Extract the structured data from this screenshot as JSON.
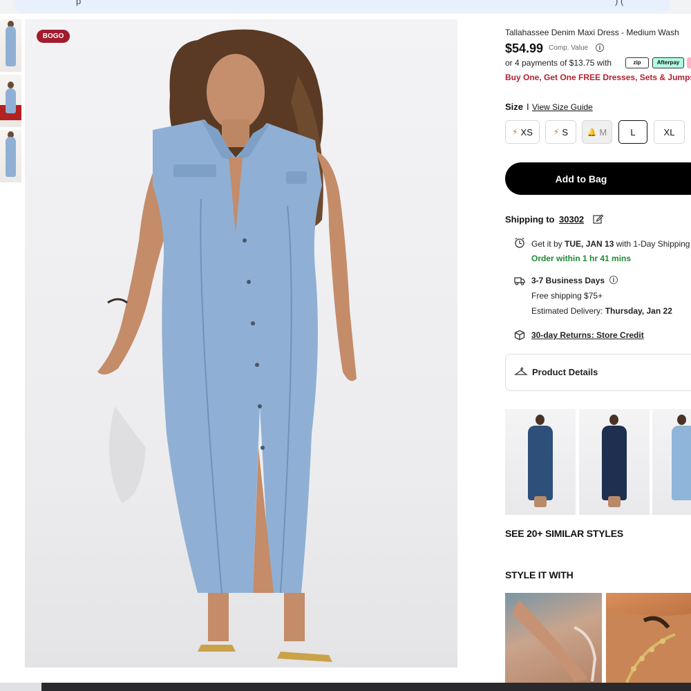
{
  "browser": {
    "ghost_left": "p",
    "ghost_right": ") ("
  },
  "product": {
    "badge": "BOGO",
    "title": "Tallahassee Denim Maxi Dress - Medium Wash",
    "price": "$54.99",
    "comp_value": "Comp. Value",
    "installments": "or 4 payments of $13.75 with",
    "payment_badges": [
      "zip",
      "Afterpay"
    ],
    "promo": "Buy One, Get One FREE Dresses, Sets & Jumpsuits"
  },
  "size": {
    "label": "Size",
    "separator": "I",
    "guide_label": "View Size Guide",
    "options": [
      {
        "label": "XS",
        "status": "low-stock"
      },
      {
        "label": "S",
        "status": "low-stock"
      },
      {
        "label": "M",
        "status": "sold-out"
      },
      {
        "label": "L",
        "status": "selected"
      },
      {
        "label": "XL",
        "status": "available"
      }
    ]
  },
  "cart": {
    "add_label": "Add to Bag"
  },
  "shipping": {
    "label": "Shipping to",
    "zip": "30302",
    "get_it_prefix": "Get it by",
    "get_it_date": "TUE, JAN 13",
    "get_it_suffix": "with 1-Day Shipping",
    "order_within": "Order within 1 hr 41 mins",
    "business_days": "3-7 Business Days",
    "free_shipping": "Free shipping $75+",
    "estimated_label": "Estimated Delivery:",
    "estimated_date": "Thursday, Jan 22",
    "returns": "30-day Returns: Store Credit"
  },
  "details": {
    "label": "Product Details"
  },
  "similar": {
    "heading": "SEE 20+ SIMILAR STYLES",
    "items": [
      {
        "color": "#2d4f7a"
      },
      {
        "color": "#1f2f4f"
      },
      {
        "color": "#8fb5d8"
      }
    ]
  },
  "style_with": {
    "heading": "STYLE IT WITH"
  },
  "colors": {
    "accent": "#000000",
    "promo_red": "#b3202e",
    "badge_red": "#a11c2d",
    "green": "#1f8a34",
    "denim": "#8fb0d4"
  },
  "icons": {
    "clock": "clock-icon",
    "truck": "truck-icon",
    "box": "box-icon",
    "hanger": "hanger-icon",
    "edit": "edit-icon",
    "bolt": "bolt-icon",
    "bell": "bell-icon",
    "info": "info-icon"
  }
}
